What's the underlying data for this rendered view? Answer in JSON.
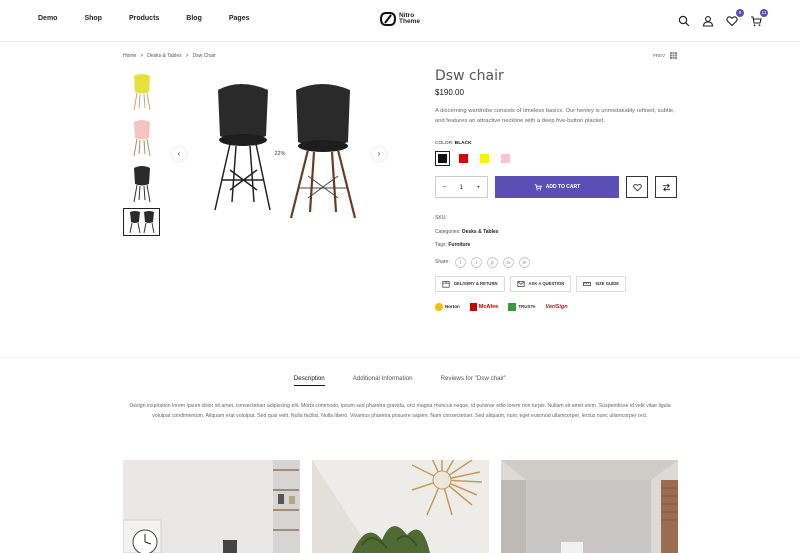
{
  "nav": {
    "items": [
      "Demo",
      "Shop",
      "Products",
      "Blog",
      "Pages"
    ]
  },
  "logo": {
    "line1": "Nitro",
    "line2": "Theme"
  },
  "header_icons": {
    "wishlist_count": "0",
    "cart_count": "11"
  },
  "breadcrumb": {
    "items": [
      "Home",
      "Desks & Tables",
      "Dsw Chair"
    ],
    "separator": ">"
  },
  "pager": {
    "prev_label": "PREV"
  },
  "product": {
    "title": "Dsw chair",
    "price": "$190.00",
    "description": "A discerning wardrobe consists of timeless basics. Our henley is unmistakably refined, subtle, and features an attractive neckline with a deep five-button placket.",
    "sale_badge": "22%",
    "color_label": "COLOR:",
    "color_value": "BLACK",
    "swatches": [
      "#111111",
      "#e00000",
      "#f5f500",
      "#f7c6d1"
    ],
    "quantity": "1",
    "qty_minus": "−",
    "qty_plus": "+",
    "add_to_cart": "ADD TO CART",
    "sku_label": "SKU:",
    "categories_label": "Categories:",
    "categories_value": "Desks & Tables",
    "tags_label": "Tags:",
    "tags_value": "Furniture",
    "share_label": "Share:",
    "share_icons": [
      "f",
      "t",
      "p",
      "in",
      "✉"
    ],
    "pills": [
      "DELIVERY & RETURN",
      "ASK A QUESTION",
      "SIZE GUIDE"
    ],
    "trust": [
      "Norton",
      "McAfee",
      "TRUSTe",
      "VeriSign"
    ]
  },
  "tabs": {
    "items": [
      "Description",
      "Additional Information",
      "Reviews for \"Dsw chair\""
    ],
    "active": 0,
    "content": "Design inspiration lorem ipsum dolor sit amet, consectetuer adipiscing elit. Morbi commodo, ipsum sed pharetra gravida, orci magna rhoncus neque, id pulvinar odio lorem non turpis. Nullam sit amet enim. Suspendisse id velit vitae ligula volutpat condimentum. Aliquam erat volutpat. Sed quis velit. Nulla facilisi. Nulla libero. Vivamus pharetra posuere sapien. Nam consectetuer. Sed aliquam, nunc eget euismod ullamcorper, lectus nunc ullamcorper orci."
  },
  "colors": {
    "accent": "#5b4fb5",
    "text": "#222222"
  }
}
